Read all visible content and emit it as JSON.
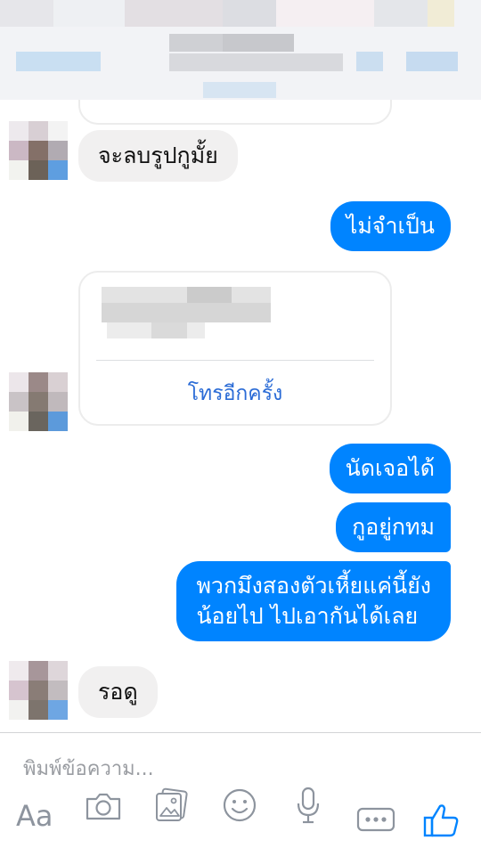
{
  "conversation": {
    "messages": [
      {
        "direction": "incoming",
        "text": "จะลบรูปกูมั้ย"
      },
      {
        "direction": "outgoing",
        "text": "ไม่จำเป็น"
      },
      {
        "direction": "incoming",
        "type": "call-card",
        "action_label": "โทรอีกครั้ง"
      },
      {
        "direction": "outgoing",
        "text": "นัดเจอได้"
      },
      {
        "direction": "outgoing",
        "text": "กูอยู่กทม"
      },
      {
        "direction": "outgoing",
        "lines": [
          "พวกมึงสองตัวเหี้ยแค่นี้ยัง",
          "น้อยไป ไปเอากันได้เลย"
        ]
      },
      {
        "direction": "incoming",
        "text": "รอดู"
      }
    ]
  },
  "composer": {
    "placeholder": "พิมพ์ข้อความ...",
    "tools": [
      {
        "label": "Aa",
        "icon": "text-format-icon"
      },
      {
        "icon": "camera-icon"
      },
      {
        "icon": "gallery-icon"
      },
      {
        "icon": "emoji-icon"
      },
      {
        "icon": "microphone-icon"
      },
      {
        "icon": "more-icon"
      },
      {
        "icon": "like-icon"
      }
    ]
  },
  "colors": {
    "outgoing_bubble": "#0084ff",
    "incoming_bubble": "#f1f0f0",
    "link": "#2a6bd6",
    "like_icon": "#0084ff"
  }
}
